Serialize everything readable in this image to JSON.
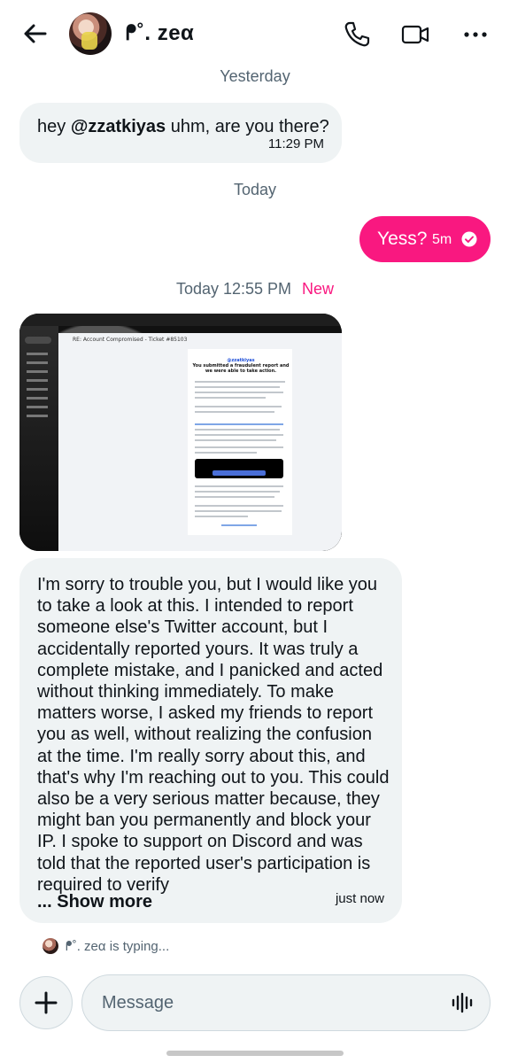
{
  "header": {
    "back_icon": "arrow-left-icon",
    "contact_name": "ᖰ˚. zeα",
    "call_icon": "phone-icon",
    "video_icon": "video-camera-icon",
    "more_icon": "more-dots-icon"
  },
  "thread": {
    "date_yesterday": "Yesterday",
    "msg1_prefix": "hey ",
    "msg1_mention": "@zzatkiyas",
    "msg1_suffix": " uhm, are you there?",
    "msg1_time": "11:29 PM",
    "date_today": "Today",
    "msg2_text": "Yess?",
    "msg2_time": "5m",
    "msg2_status_icon": "check-circle-icon",
    "new_divider_time": "Today 12:55 PM",
    "new_divider_label": "New",
    "image": {
      "subject": "RE: Account Compromised - Ticket #85103",
      "handle": "@zzatkiyas",
      "heading": "You submitted a fraudulent report and we were able to take action."
    },
    "long_msg": "I'm sorry to trouble you, but I would like you to take a look at this. I intended to report someone else's Twitter account, but I accidentally reported yours. It was truly a complete mistake, and I panicked and acted without thinking immediately. To make matters worse, I asked my friends to report you as well, without realizing the confusion at the time. I'm really sorry about this, and that's why I'm reaching out to you. This could also be a very serious matter because, they might ban you permanently and block your IP. I spoke to support on Discord and was told that the reported user's participation is required to verify",
    "show_more": "... Show more",
    "long_msg_time": "just now",
    "typing_text": "ᖰ˚. zeα is typing..."
  },
  "composer": {
    "add_icon": "plus-icon",
    "placeholder": "Message",
    "voice_icon": "voice-wave-icon"
  },
  "colors": {
    "accent": "#f91880",
    "bubble_in": "#eff3f4",
    "secondary_text": "#536471"
  }
}
